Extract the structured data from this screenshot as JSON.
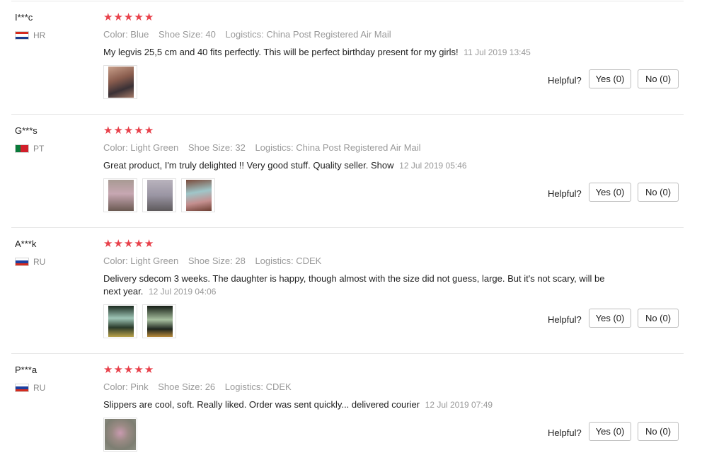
{
  "helpful_label": "Helpful?",
  "star_glyph": "★",
  "colors": {
    "star": "#e8414b",
    "meta": "#999999",
    "divider": "#e8e8e8"
  },
  "reviews": [
    {
      "user": "I***c",
      "country": "HR",
      "flag": "croatia-flag",
      "stars": 5,
      "color": "Color: Blue",
      "size": "Shoe Size: 40",
      "logistics": "Logistics: China Post Registered Air Mail",
      "text": "My legvis 25,5 cm and 40 fits perfectly. This will be perfect birthday present for my girls!",
      "date": "11 Jul 2019 13:45",
      "photos": 1,
      "yes": "Yes (0)",
      "no": "No (0)"
    },
    {
      "user": "G***s",
      "country": "PT",
      "flag": "portugal-flag",
      "stars": 5,
      "color": "Color: Light Green",
      "size": "Shoe Size: 32",
      "logistics": "Logistics: China Post Registered Air Mail",
      "text": "Great product, I'm truly delighted !! Very good stuff. Quality seller. Show",
      "date": "12 Jul 2019 05:46",
      "photos": 3,
      "yes": "Yes (0)",
      "no": "No (0)"
    },
    {
      "user": "A***k",
      "country": "RU",
      "flag": "russia-flag",
      "stars": 5,
      "color": "Color: Light Green",
      "size": "Shoe Size: 28",
      "logistics": "Logistics: CDEK",
      "text": "Delivery sdecom 3 weeks. The daughter is happy, though almost with the size did not guess, large. But it's not scary, will be next year.",
      "date": "12 Jul 2019 04:06",
      "photos": 2,
      "yes": "Yes (0)",
      "no": "No (0)"
    },
    {
      "user": "P***a",
      "country": "RU",
      "flag": "russia-flag",
      "stars": 5,
      "color": "Color: Pink",
      "size": "Shoe Size: 26",
      "logistics": "Logistics: CDEK",
      "text": "Slippers are cool, soft. Really liked. Order was sent quickly... delivered courier",
      "date": "12 Jul 2019 07:49",
      "photos": 1,
      "yes": "Yes (0)",
      "no": "No (0)"
    }
  ]
}
